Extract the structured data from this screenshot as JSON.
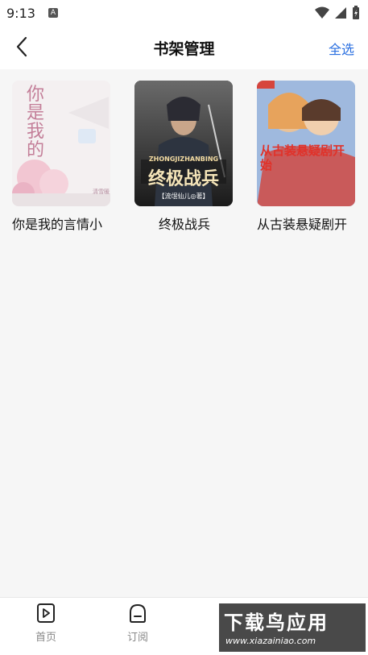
{
  "status": {
    "time": "9:13",
    "notif": "A"
  },
  "header": {
    "title": "书架管理",
    "select_all": "全选"
  },
  "books": [
    {
      "title": "你是我的言情小",
      "cover_text": "你是我的",
      "cover_bg": "#f3eef0"
    },
    {
      "title": "终极战兵",
      "cover_text": "终极战兵",
      "cover_sub": "ZHONGJIZHANBING",
      "cover_author": "【流氓仙儿◎著】",
      "cover_bg": "#2a2a2a"
    },
    {
      "title": "从古装悬疑剧开",
      "cover_text": "从古装悬疑剧开始",
      "cover_bg": "#8fb0d8"
    }
  ],
  "nav": {
    "home": "首页",
    "subscribe": "订阅"
  },
  "watermark": {
    "main": "下载鸟应用",
    "sub": "www.xiazainiao.com"
  },
  "colors": {
    "accent": "#2a6fe0"
  }
}
